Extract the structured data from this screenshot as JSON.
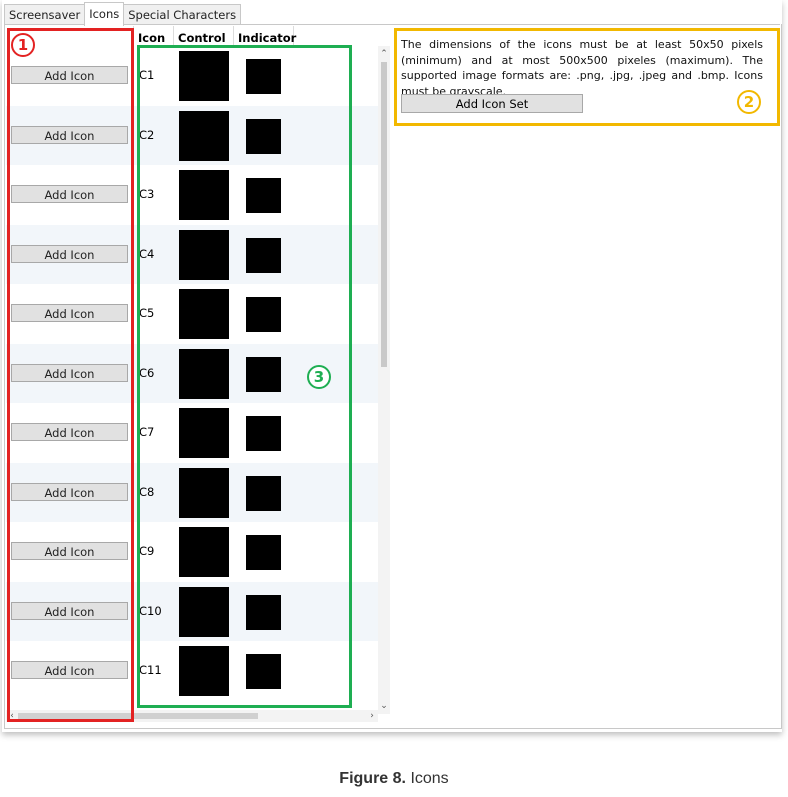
{
  "tabs": [
    {
      "label": "Screensaver",
      "active": false
    },
    {
      "label": "Icons",
      "active": true
    },
    {
      "label": "Special Characters",
      "active": false
    }
  ],
  "grid": {
    "headers": {
      "icon": "Icon",
      "control": "Control",
      "indicator": "Indicator"
    },
    "rows": [
      {
        "button": "Add Icon",
        "icon": "C1"
      },
      {
        "button": "Add Icon",
        "icon": "C2"
      },
      {
        "button": "Add Icon",
        "icon": "C3"
      },
      {
        "button": "Add Icon",
        "icon": "C4"
      },
      {
        "button": "Add Icon",
        "icon": "C5"
      },
      {
        "button": "Add Icon",
        "icon": "C6"
      },
      {
        "button": "Add Icon",
        "icon": "C7"
      },
      {
        "button": "Add Icon",
        "icon": "C8"
      },
      {
        "button": "Add Icon",
        "icon": "C9"
      },
      {
        "button": "Add Icon",
        "icon": "C10"
      },
      {
        "button": "Add Icon",
        "icon": "C11"
      }
    ]
  },
  "info": {
    "text": "The dimensions of the icons must be at least 50x50 pixels (minimum) and at most 500x500 pixeles (maximum). The supported image formats are: .png, .jpg, .jpeg and .bmp. Icons must be grayscale.",
    "button": "Add Icon Set"
  },
  "annotations": {
    "one": "1",
    "two": "2",
    "three": "3"
  },
  "colors": {
    "red": "#e32222",
    "yellow": "#f2b800",
    "green": "#1eae52"
  },
  "caption": {
    "figure": "Figure 8.",
    "title": "Icons"
  }
}
